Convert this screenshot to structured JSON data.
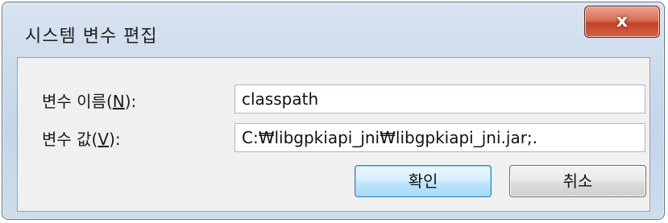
{
  "window": {
    "title": "시스템 변수 편집",
    "close_glyph": "x"
  },
  "form": {
    "name_label_prefix": "변수 이름(",
    "name_label_mnemonic": "N",
    "name_label_suffix": "):",
    "name_value": "classpath",
    "value_label_prefix": "변수 값(",
    "value_label_mnemonic": "V",
    "value_label_suffix": "):",
    "value_value": "C:₩libgpkiapi_jni₩libgpkiapi_jni.jar;."
  },
  "buttons": {
    "ok_label": "확인",
    "cancel_label": "취소"
  },
  "colors": {
    "close_button": "#c8482e",
    "ok_button_border": "#3c7fb1",
    "window_frame": "#cddbeb"
  },
  "icons": {
    "close": "close-icon"
  }
}
